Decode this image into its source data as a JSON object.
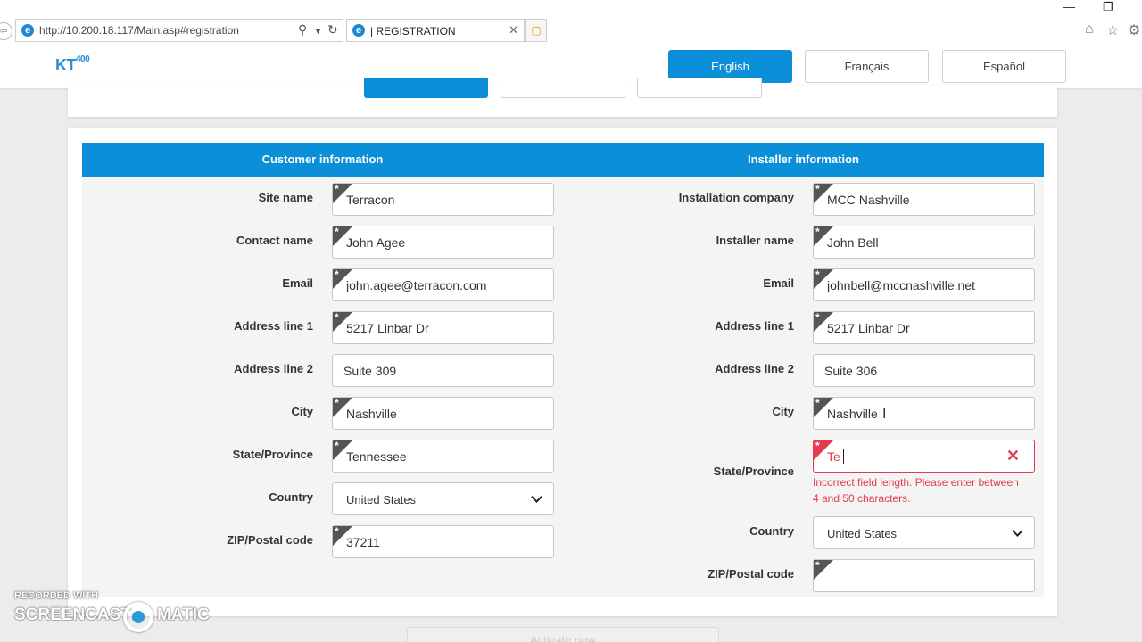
{
  "browser": {
    "url": "http://10.200.18.117/Main.asp#registration",
    "tab_title": "| REGISTRATION",
    "tab_close": "✕"
  },
  "header": {
    "logo": "KT",
    "logo_sup": "400",
    "languages": [
      "English",
      "Français",
      "Español"
    ],
    "active_language": "English"
  },
  "customer": {
    "title": "Customer information",
    "fields": [
      {
        "label": "Site name",
        "value": "Terracon",
        "required": true
      },
      {
        "label": "Contact name",
        "value": "John Agee",
        "required": true
      },
      {
        "label": "Email",
        "value": "john.agee@terracon.com",
        "required": true
      },
      {
        "label": "Address line 1",
        "value": "5217 Linbar Dr",
        "required": true
      },
      {
        "label": "Address line 2",
        "value": "Suite 309",
        "required": false
      },
      {
        "label": "City",
        "value": "Nashville",
        "required": true
      },
      {
        "label": "State/Province",
        "value": "Tennessee",
        "required": true
      },
      {
        "label": "Country",
        "value": "United States",
        "type": "select"
      },
      {
        "label": "ZIP/Postal code",
        "value": "37211",
        "required": true
      }
    ]
  },
  "installer": {
    "title": "Installer information",
    "fields": [
      {
        "label": "Installation company",
        "value": "MCC Nashville",
        "required": true
      },
      {
        "label": "Installer name",
        "value": "John Bell",
        "required": true
      },
      {
        "label": "Email",
        "value": "johnbell@mccnashville.net",
        "required": true
      },
      {
        "label": "Address line 1",
        "value": "5217 Linbar Dr",
        "required": true
      },
      {
        "label": "Address line 2",
        "value": "Suite 306",
        "required": false
      },
      {
        "label": "City",
        "value": "Nashville",
        "required": true
      },
      {
        "label": "State/Province",
        "value": "Te",
        "required": true,
        "error": "Incorrect field length. Please enter between 4 and 50 characters."
      },
      {
        "label": "Country",
        "value": "United States",
        "type": "select"
      },
      {
        "label": "ZIP/Postal code",
        "value": "",
        "required": true
      }
    ]
  },
  "bottom_button": "Activate now",
  "watermark": {
    "line1": "RECORDED WITH",
    "line2a": "SCREENCAST",
    "line2b": "MATIC"
  },
  "colors": {
    "accent": "#0a8fd8",
    "error": "#e33a4d"
  }
}
